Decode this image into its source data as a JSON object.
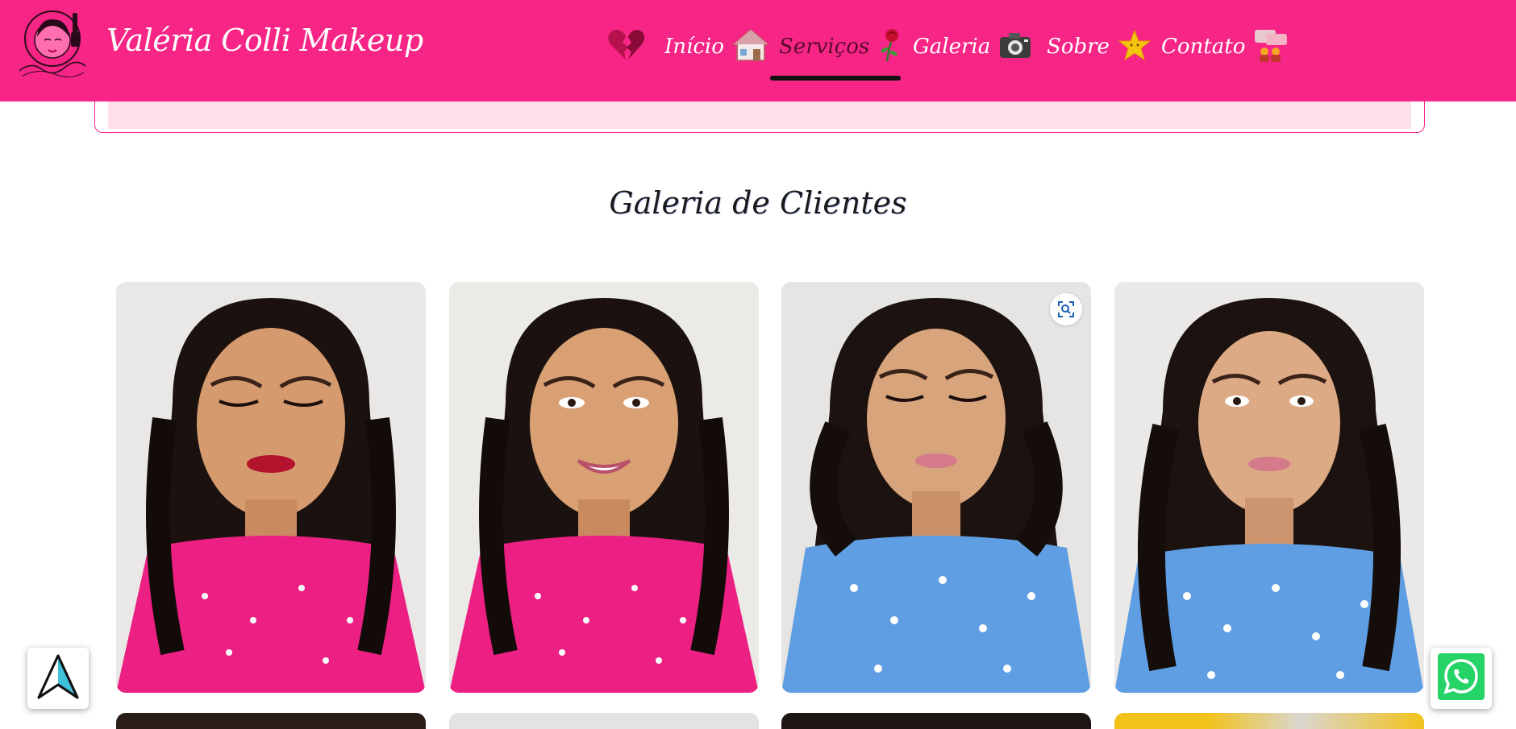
{
  "brand": {
    "name": "Valéria Colli Makeup",
    "logo_icon": "makeup-face-logo"
  },
  "nav": {
    "items": [
      {
        "label": "",
        "icon": "broken-heart-icon"
      },
      {
        "label": "Início",
        "icon": "house-icon"
      },
      {
        "label": "Serviços",
        "icon": "rose-icon",
        "active": true
      },
      {
        "label": "Galeria",
        "icon": "camera-icon"
      },
      {
        "label": "Sobre",
        "icon": "star-icon"
      },
      {
        "label": "Contato",
        "icon": "speech-bubbles-icon"
      }
    ]
  },
  "gallery": {
    "title": "Galeria de Clientes",
    "photos": [
      {
        "outfit": "pink dress with hearts",
        "color": "#ec1f83"
      },
      {
        "outfit": "pink dress with hearts",
        "color": "#ec1f83"
      },
      {
        "outfit": "blue floral dress",
        "color": "#5f9ee3"
      },
      {
        "outfit": "blue floral dress",
        "color": "#5f9ee3"
      }
    ]
  },
  "floating": {
    "left_icon": "navigation-arrow-icon",
    "right_icon": "whatsapp-icon"
  },
  "colors": {
    "header": "#f72585",
    "info_box": "#ffe0ec",
    "whatsapp": "#25d366"
  }
}
